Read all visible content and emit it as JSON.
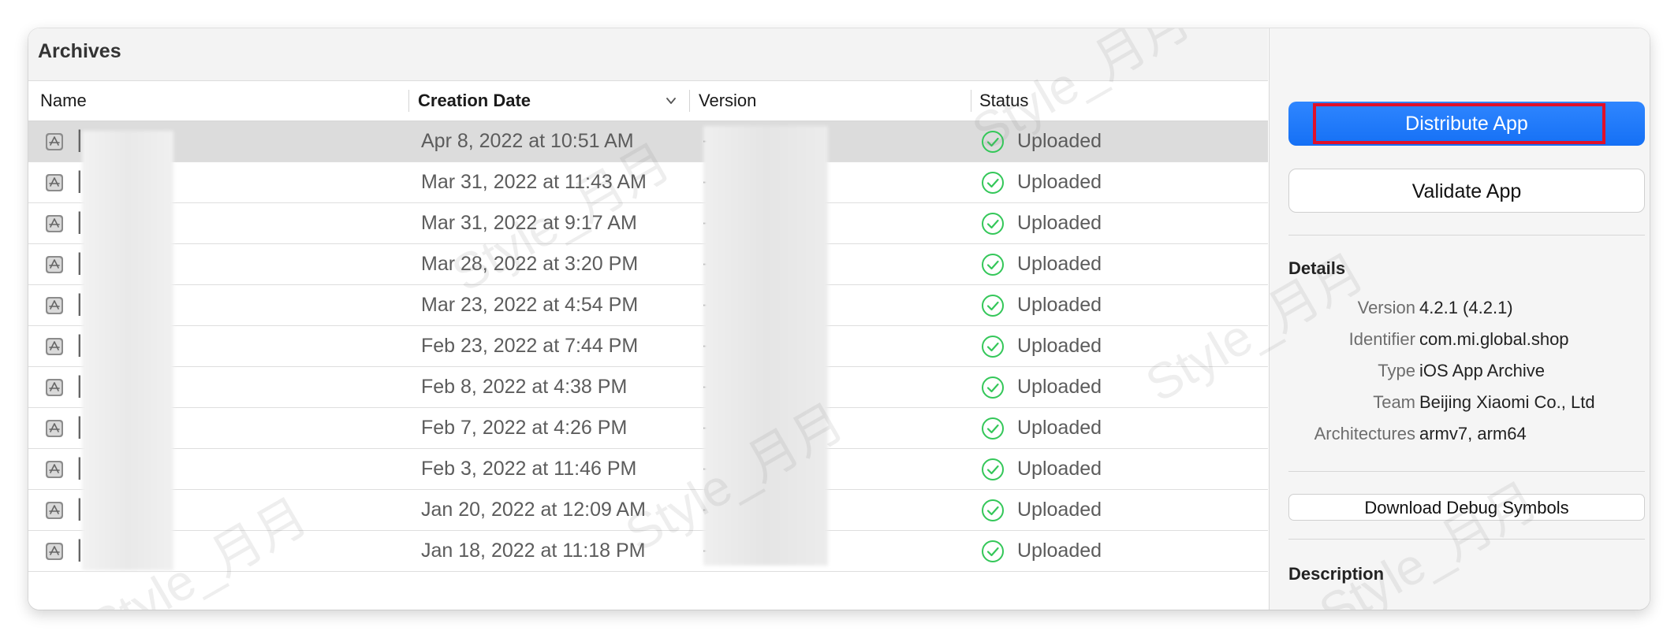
{
  "window": {
    "title": "Archives"
  },
  "columns": {
    "name": "Name",
    "creation_date": "Creation Date",
    "version": "Version",
    "status": "Status"
  },
  "archives": [
    {
      "date": "Apr 8, 2022 at 10:51 AM",
      "status": "Uploaded",
      "selected": true
    },
    {
      "date": "Mar 31, 2022 at 11:43 AM",
      "status": "Uploaded"
    },
    {
      "date": "Mar 31, 2022 at 9:17 AM",
      "status": "Uploaded"
    },
    {
      "date": "Mar 28, 2022 at 3:20 PM",
      "status": "Uploaded"
    },
    {
      "date": "Mar 23, 2022 at 4:54 PM",
      "status": "Uploaded"
    },
    {
      "date": "Feb 23, 2022 at 7:44 PM",
      "status": "Uploaded"
    },
    {
      "date": "Feb 8, 2022 at 4:38 PM",
      "status": "Uploaded"
    },
    {
      "date": "Feb 7, 2022 at 4:26 PM",
      "status": "Uploaded"
    },
    {
      "date": "Feb 3, 2022 at 11:46 PM",
      "status": "Uploaded"
    },
    {
      "date": "Jan 20, 2022 at 12:09 AM",
      "status": "Uploaded"
    },
    {
      "date": "Jan 18, 2022 at 11:18 PM",
      "status": "Uploaded"
    }
  ],
  "sidebar": {
    "distribute_label": "Distribute App",
    "validate_label": "Validate App",
    "details_title": "Details",
    "details": [
      {
        "label": "Version",
        "value": "4.2.1 (4.2.1)"
      },
      {
        "label": "Identifier",
        "value": "com.mi.global.shop"
      },
      {
        "label": "Type",
        "value": "iOS App Archive"
      },
      {
        "label": "Team",
        "value": "Beijing Xiaomi Co., Ltd"
      },
      {
        "label": "Architectures",
        "value": "armv7, arm64"
      }
    ],
    "debug_symbols_label": "Download Debug Symbols",
    "description_title": "Description"
  },
  "watermark_text": "Style_月月",
  "colors": {
    "accent": "#1570f5",
    "success": "#34c759",
    "highlight": "#e0102a",
    "selected_row": "#dcdcdc"
  },
  "icons": {
    "row": "app-archive-icon",
    "status": "checkmark-circle-icon",
    "sort": "chevron-down-icon"
  }
}
